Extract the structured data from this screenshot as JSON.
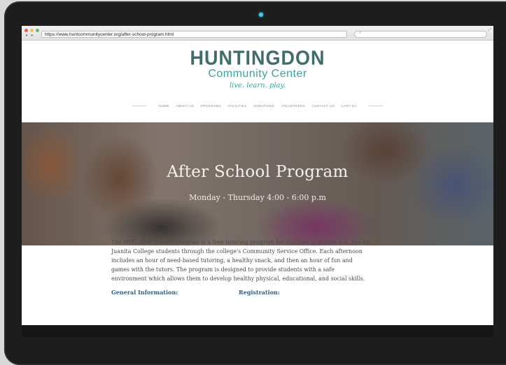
{
  "browser": {
    "url": "https://www.huntcommunitycenter.org/after-school-program.html",
    "nav_arrows": "◂ ▸"
  },
  "site": {
    "logo_main": "HUNTINGDON",
    "logo_sub": "Community Center",
    "tagline": "live. learn. play.",
    "menu": [
      "HOME",
      "ABOUT US",
      "PROGRAMS",
      "FACILITIES",
      "DONATIONS",
      "VOLUNTEERS",
      "CONTACT US",
      "CART (0)"
    ]
  },
  "hero": {
    "title": "After School Program",
    "subtitle": "Monday - Thursday 4:00 - 6:00 p.m"
  },
  "content": {
    "intro": "The HCC After School Program is a free tutoring program for children in grades K-6, run by Juanita College students through the college's Community Service Office. Each afternoon includes an hour of need-based tutoring, a healthy snack, and then an hour of fun and games with the tutors. The program is designed to provide students with a safe environment which allows them to develop healthy physical, educational, and social skills.",
    "col_left_heading": "General Information:",
    "col_right_heading": "Registration:"
  },
  "colors": {
    "logo_main": "#3f6d6b",
    "logo_accent": "#38a39c",
    "heading_blue": "#2e5f86",
    "camera_led": "#3ad0e0"
  }
}
